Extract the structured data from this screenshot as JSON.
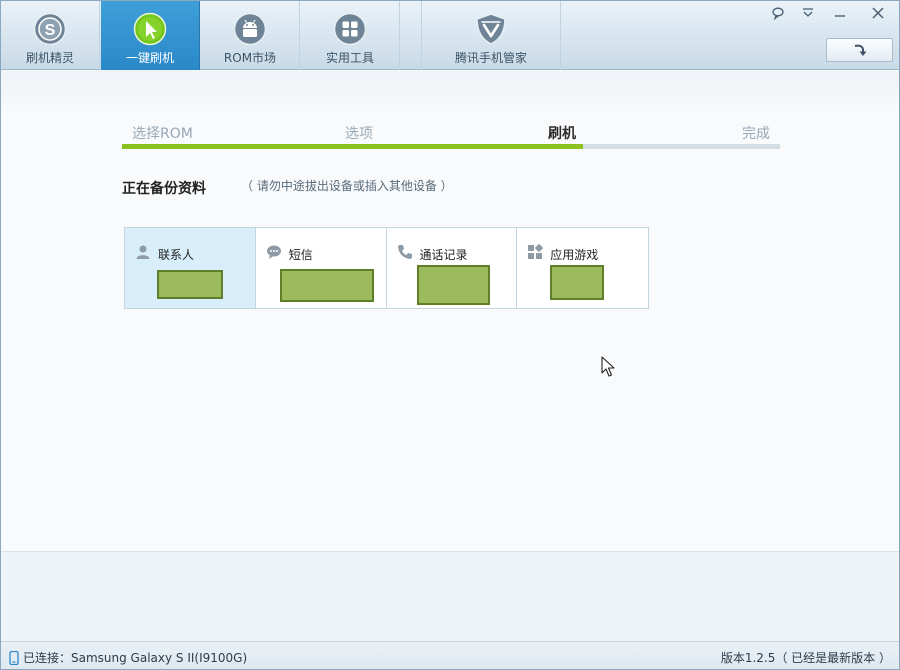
{
  "toolbar": {
    "tabs": [
      {
        "label": "刷机精灵",
        "icon": "shuajijingling-logo-icon"
      },
      {
        "label": "一键刷机",
        "icon": "one-click-flash-icon"
      },
      {
        "label": "ROM市场",
        "icon": "android-rom-market-icon"
      },
      {
        "label": "实用工具",
        "icon": "tools-grid-icon"
      },
      {
        "label": "腾讯手机管家",
        "icon": "tencent-shield-icon"
      }
    ],
    "active_tab": 1
  },
  "window_controls": [
    "feedback-icon",
    "dropdown-menu-icon",
    "minimize-icon",
    "close-icon"
  ],
  "steps": {
    "items": [
      "选择ROM",
      "选项",
      "刷机",
      "完成"
    ],
    "current": 2,
    "progress_percent": 70
  },
  "backup": {
    "title": "正在备份资料",
    "hint": "（ 请勿中途拔出设备或插入其他设备 ）",
    "items": [
      {
        "label": "联系人",
        "icon": "person-icon"
      },
      {
        "label": "短信",
        "icon": "chat-bubble-icon"
      },
      {
        "label": "通话记录",
        "icon": "phone-icon"
      },
      {
        "label": "应用游戏",
        "icon": "apps-grid-icon"
      }
    ]
  },
  "status": {
    "connection": "已连接：Samsung Galaxy S II(I9100G)",
    "version": "版本1.2.5（ 已经是最新版本 ）"
  },
  "colors": {
    "accent_blue": "#2a88c8",
    "progress_green": "#8cc11f",
    "redaction_fill": "#9bbb5c"
  }
}
